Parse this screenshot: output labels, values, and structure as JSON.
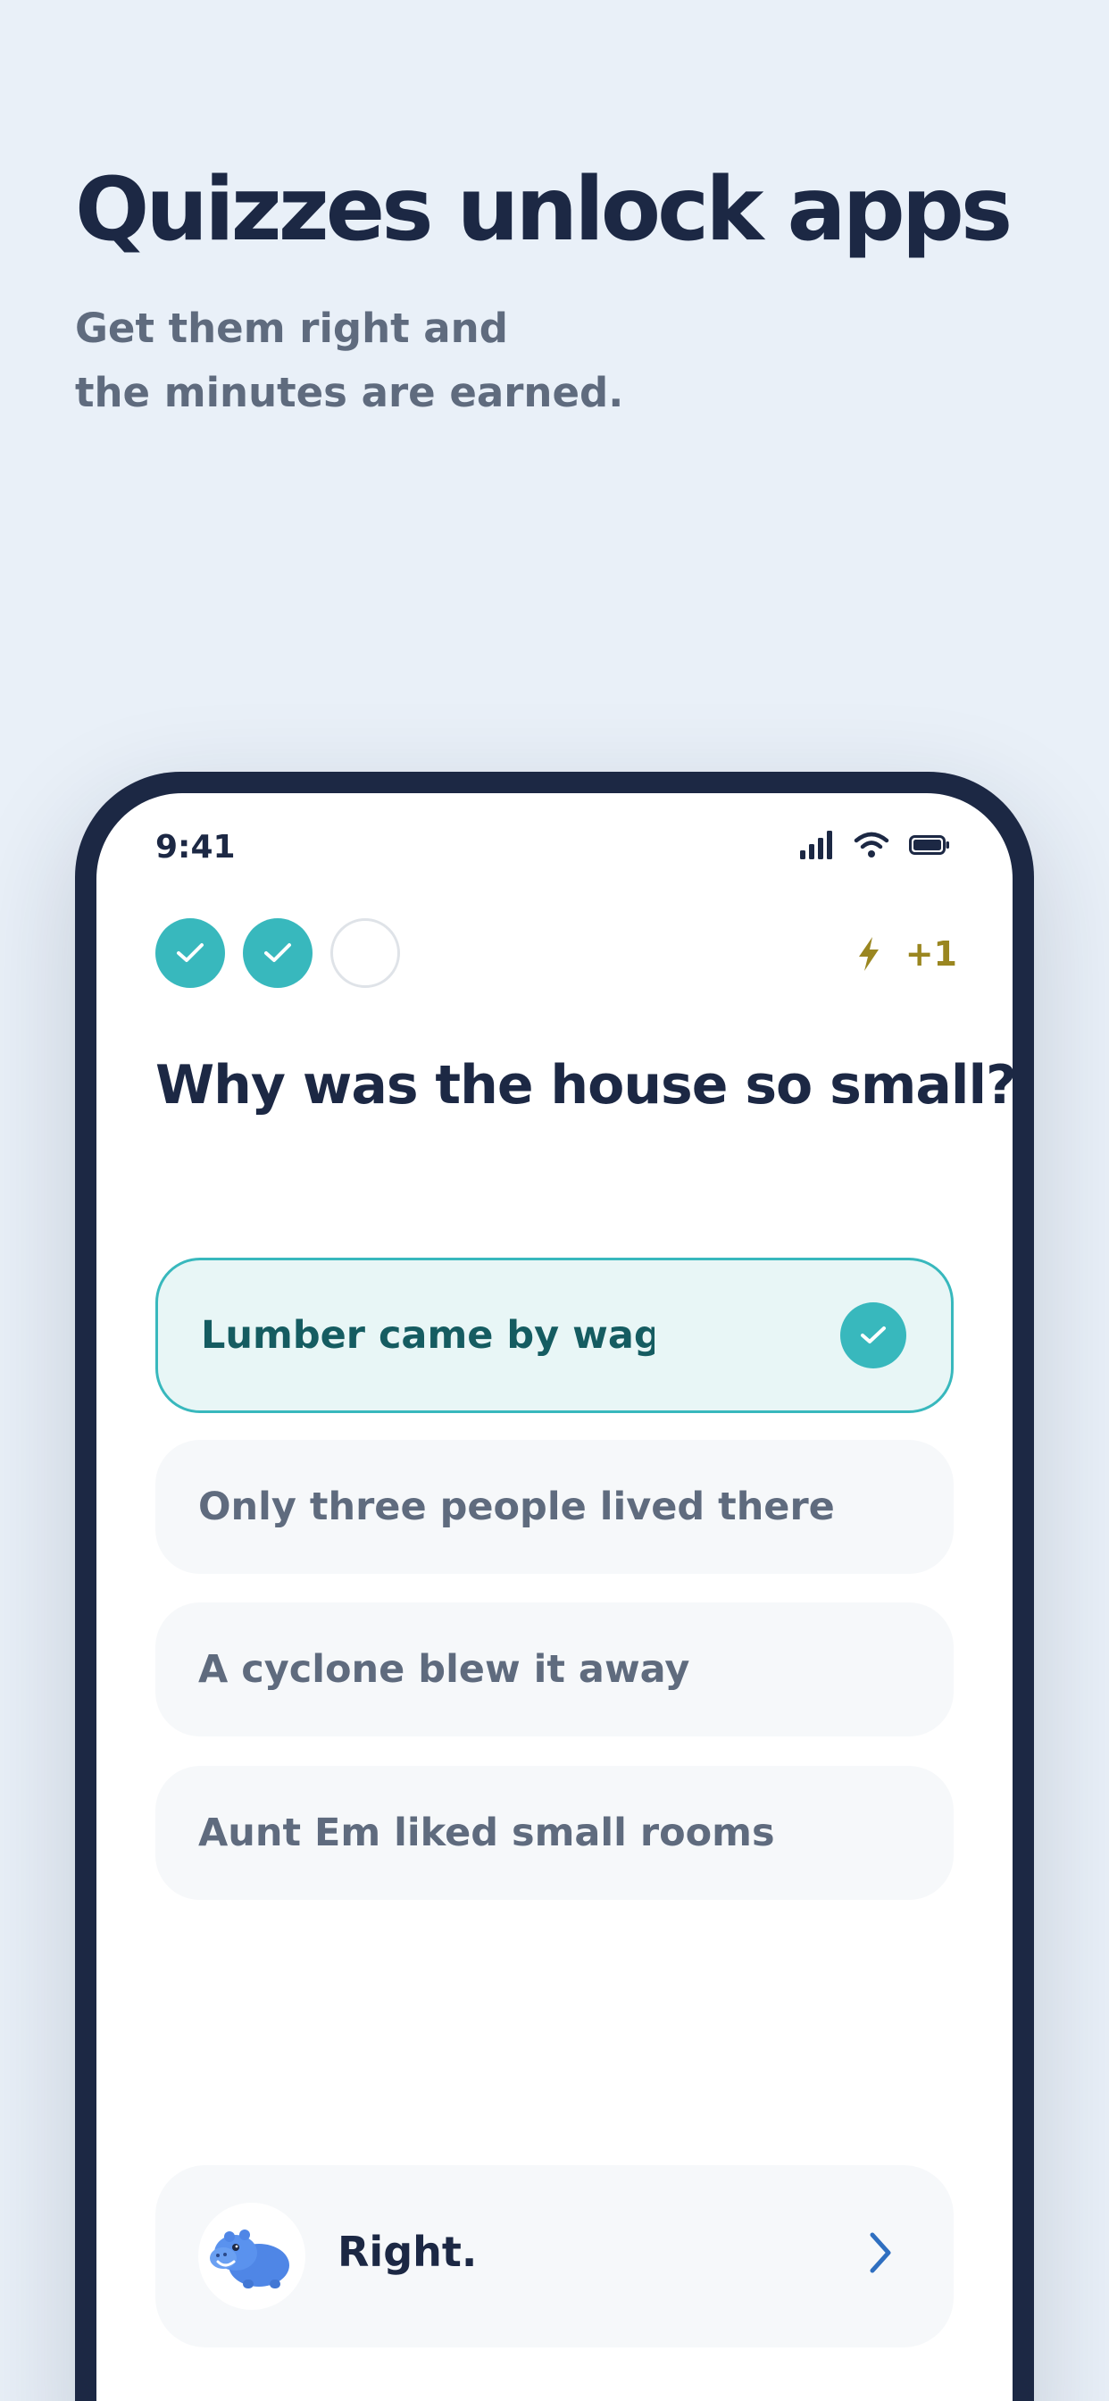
{
  "marketing": {
    "headline": "Quizzes unlock apps",
    "subline_1": "Get them right and",
    "subline_2": "the minutes are earned."
  },
  "status_bar": {
    "time": "9:41",
    "icons": [
      "cellular-signal-icon",
      "wifi-icon",
      "battery-icon"
    ]
  },
  "quiz": {
    "progress": [
      {
        "state": "done",
        "icon": "check-icon"
      },
      {
        "state": "done",
        "icon": "check-icon"
      },
      {
        "state": "empty"
      }
    ],
    "bonus": {
      "icon": "lightning-bolt-icon",
      "text": "+1"
    },
    "question": "Why was the house so small?",
    "answers": [
      {
        "label": "Lumber came by wagon",
        "selected": true
      },
      {
        "label": "Only three people lived there",
        "selected": false
      },
      {
        "label": "A cyclone blew it away",
        "selected": false
      },
      {
        "label": "Aunt Em liked small rooms",
        "selected": false
      }
    ]
  },
  "feedback": {
    "avatar_icon": "hippo-mascot-icon",
    "text": "Right.",
    "next_icon": "chevron-right-icon"
  },
  "colors": {
    "background": "#e9f0f8",
    "navy": "#1c2844",
    "teal": "#38b8bd",
    "teal_dark": "#155c61",
    "gold": "#9a8620",
    "muted": "#5f6b7e"
  }
}
